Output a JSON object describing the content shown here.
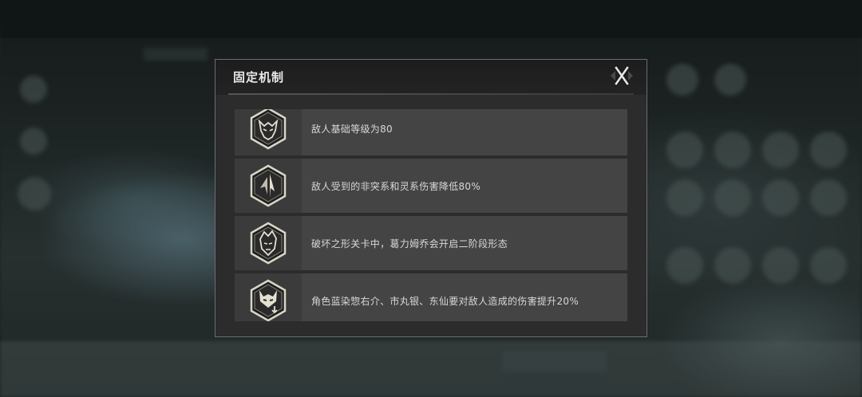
{
  "dialog": {
    "title": "固定机制",
    "close_icon": "close-x-icon"
  },
  "mechanics": [
    {
      "icon": "demon-mask-icon",
      "text": "敌人基础等级为80"
    },
    {
      "icon": "blade-crest-icon",
      "text": "敌人受到的非突系和灵系伤害降低80%"
    },
    {
      "icon": "character-portrait-icon",
      "text": "破坏之形关卡中，葛力姆乔会开启二阶段形态"
    },
    {
      "icon": "horned-mask-down-icon",
      "text": "角色蓝染惣右介、市丸银、东仙要对敌人造成的伤害提升20%"
    }
  ],
  "colors": {
    "panel": "#2c2c2c",
    "row": "#444444",
    "border": "#6d6d6d",
    "text": "#d8d8d8"
  }
}
